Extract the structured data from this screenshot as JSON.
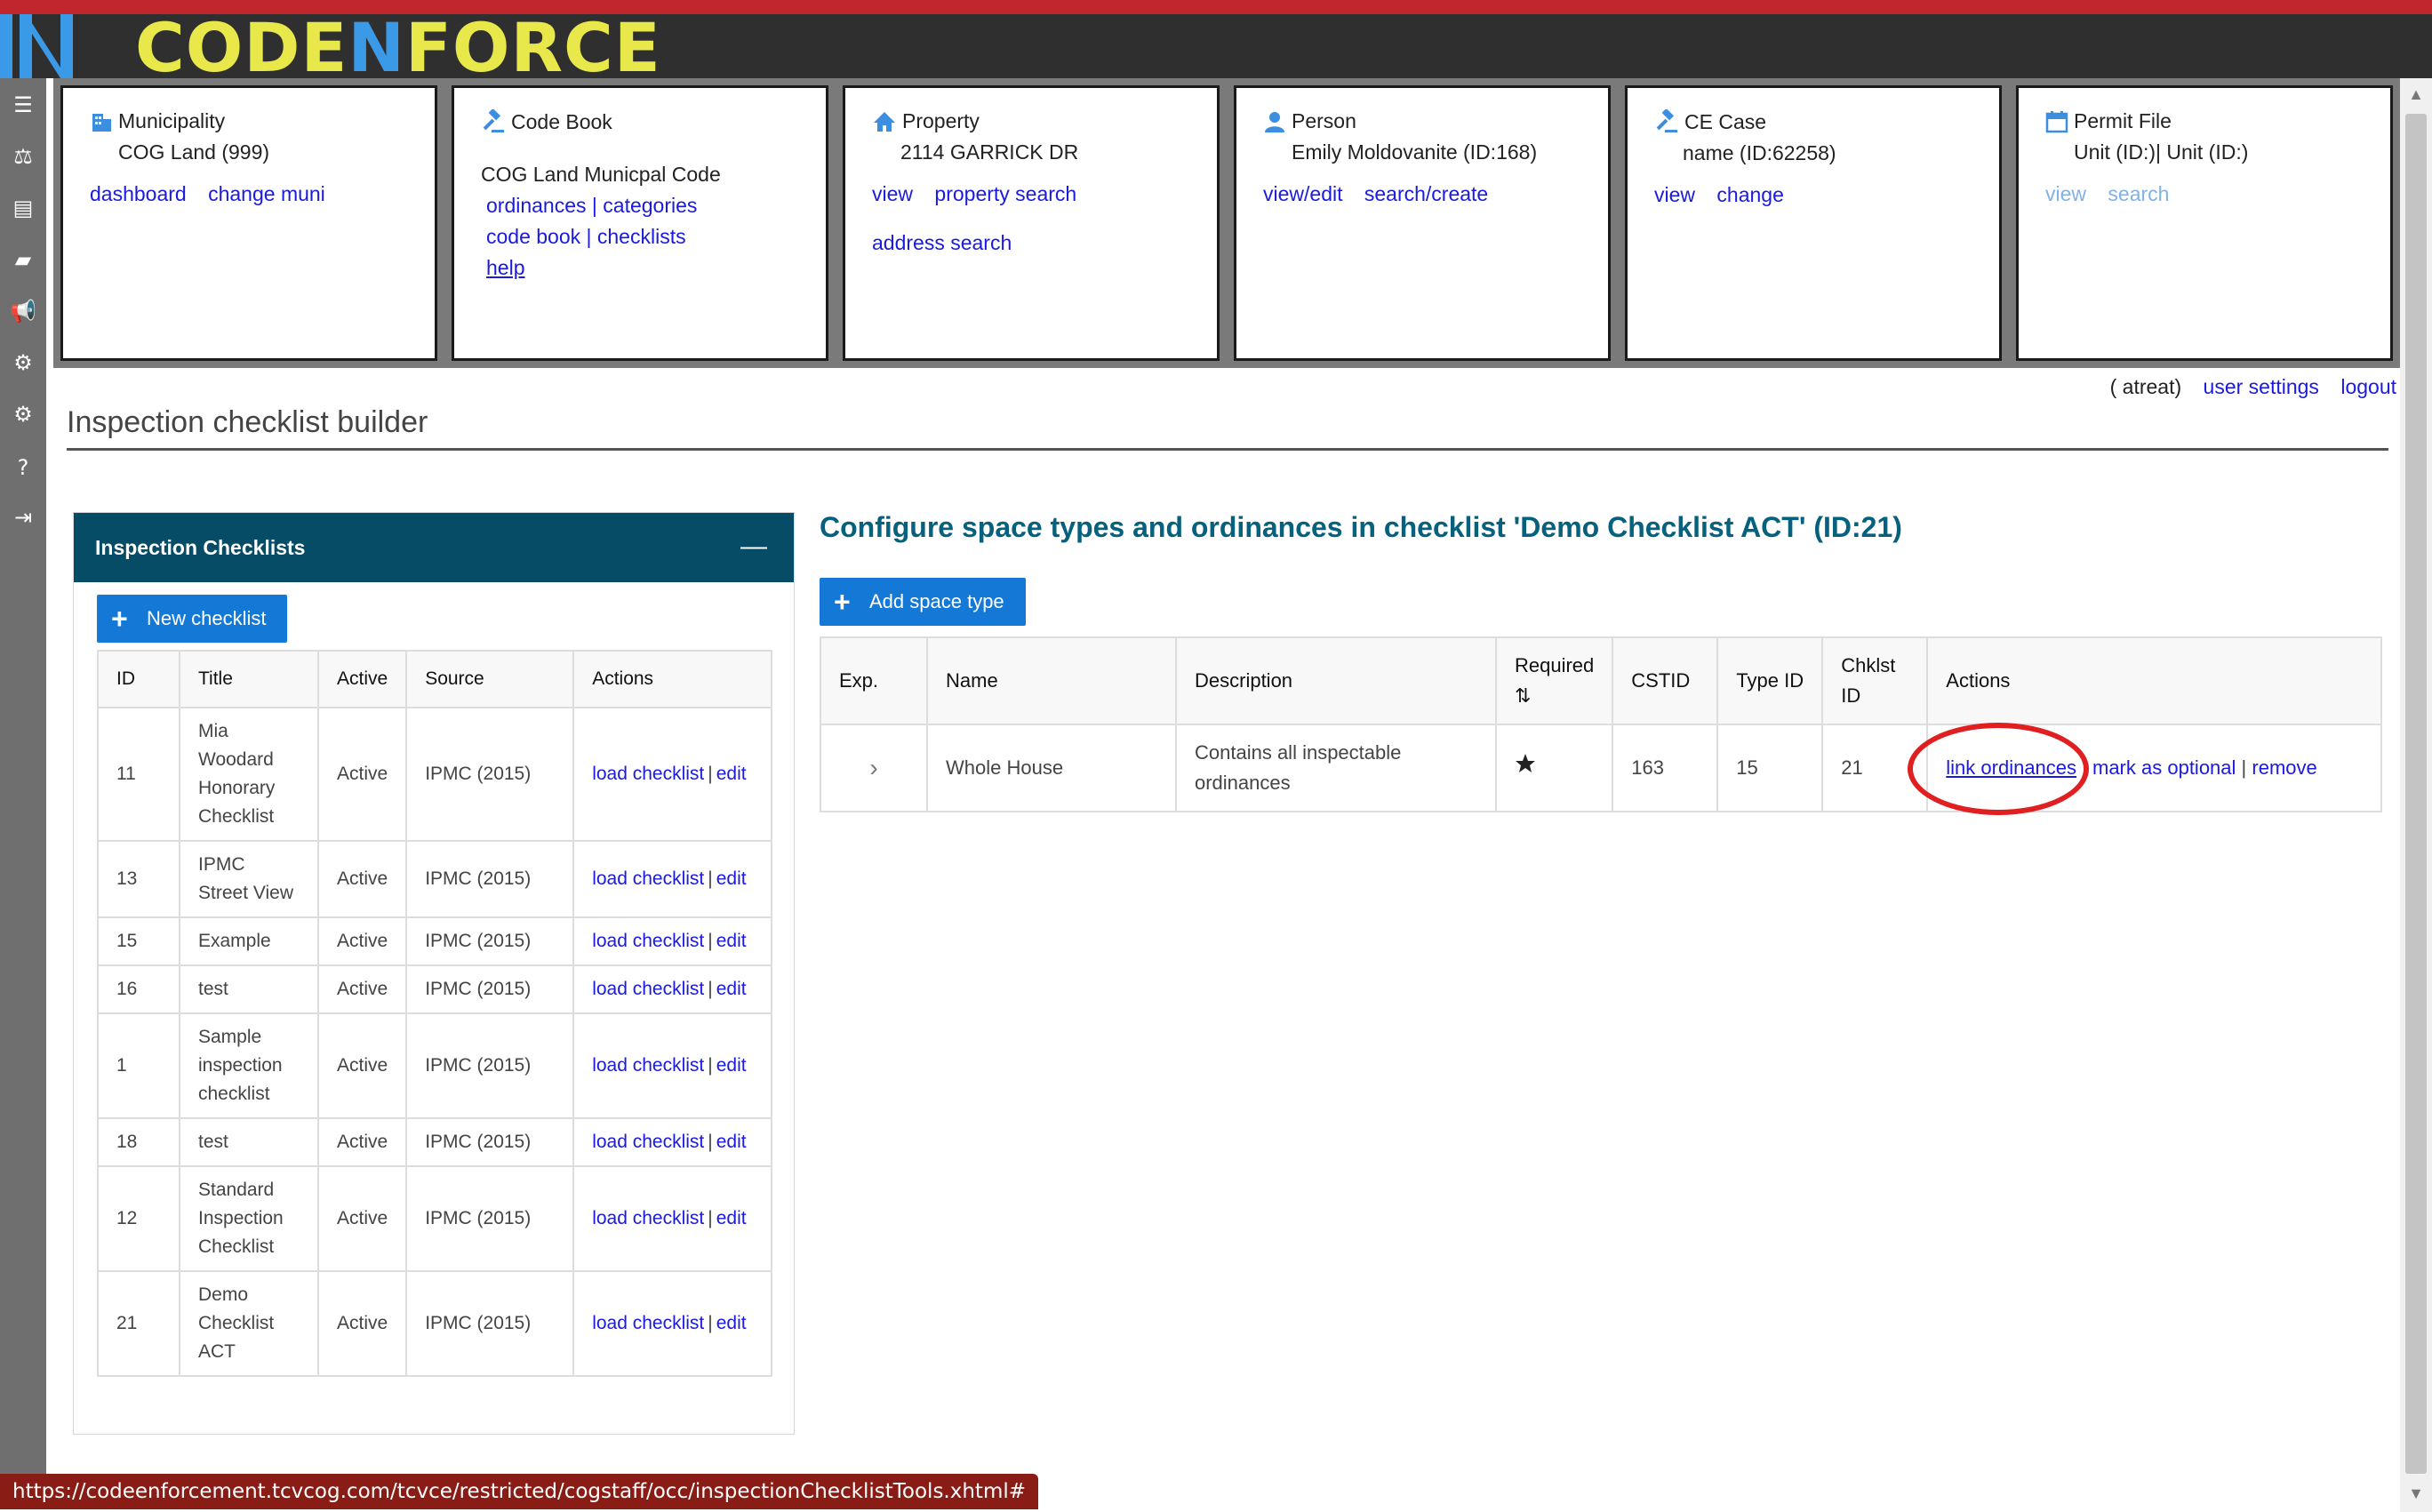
{
  "app": {
    "logo_text": "CODENFORCE",
    "colors": {
      "header": "#2f2f2f",
      "brand_yellow": "#e8e84a",
      "brand_blue": "#3b9ae8",
      "panel_head": "#074c67",
      "button": "#1479d6",
      "link": "#1a1ae0",
      "highlight_circle": "#e02020"
    }
  },
  "sidebar": {
    "icons": [
      "list-icon",
      "scales-icon",
      "card-icon",
      "book-icon",
      "megaphone-icon",
      "gears-icon",
      "gears-icon",
      "help-icon",
      "logout-icon"
    ]
  },
  "cards": {
    "municipality": {
      "title": "Municipality",
      "value": "COG Land (999)",
      "links": [
        "dashboard",
        "change muni"
      ]
    },
    "codebook": {
      "title": "Code Book",
      "value": "COG Land Municpal Code",
      "links": [
        "ordinances | categories",
        "code book | checklists",
        "help"
      ]
    },
    "property": {
      "title": "Property",
      "value": "2114 GARRICK DR",
      "links": [
        "view",
        "property search",
        "address search"
      ]
    },
    "person": {
      "title": "Person",
      "value": "Emily Moldovanite (ID:168)",
      "links": [
        "view/edit",
        "search/create"
      ]
    },
    "cecase": {
      "title": "CE Case",
      "value": "name (ID:62258)",
      "links": [
        "view",
        "change"
      ]
    },
    "permit": {
      "title": "Permit File",
      "value": "Unit (ID:)| Unit (ID:)",
      "links": [
        "view",
        "search"
      ]
    }
  },
  "user": {
    "name": "( atreat)",
    "settings": "user settings",
    "logout": "logout"
  },
  "page_title": "Inspection checklist builder",
  "left_panel": {
    "title": "Inspection Checklists",
    "collapse": "—",
    "new_button": "New checklist",
    "columns": [
      "ID",
      "Title",
      "Active",
      "Source",
      "Actions"
    ],
    "load_label": "load checklist",
    "sep": "|",
    "edit_label": "edit",
    "rows": [
      {
        "id": "11",
        "title": "Mia Woodard Honorary Checklist",
        "active": "Active",
        "source": "IPMC (2015)"
      },
      {
        "id": "13",
        "title": "IPMC Street View",
        "active": "Active",
        "source": "IPMC (2015)"
      },
      {
        "id": "15",
        "title": "Example",
        "active": "Active",
        "source": "IPMC (2015)"
      },
      {
        "id": "16",
        "title": "test",
        "active": "Active",
        "source": "IPMC (2015)"
      },
      {
        "id": "1",
        "title": "Sample inspection checklist",
        "active": "Active",
        "source": "IPMC (2015)"
      },
      {
        "id": "18",
        "title": "test",
        "active": "Active",
        "source": "IPMC (2015)"
      },
      {
        "id": "12",
        "title": "Standard Inspection Checklist",
        "active": "Active",
        "source": "IPMC (2015)"
      },
      {
        "id": "21",
        "title": "Demo Checklist ACT",
        "active": "Active",
        "source": "IPMC (2015)"
      }
    ]
  },
  "right_panel": {
    "title": "Configure space types and ordinances in checklist 'Demo Checklist ACT' (ID:21)",
    "add_button": "Add space type",
    "columns": {
      "exp": "Exp.",
      "name": "Name",
      "description": "Description",
      "required": "Required",
      "sort_icon": "⇅",
      "cstid": "CSTID",
      "typeid": "Type ID",
      "chklist": "Chklst ID",
      "actions": "Actions"
    },
    "row": {
      "expand_icon": "chevron-right-icon",
      "name": "Whole House",
      "description": "Contains all inspectable ordinances",
      "required_icon": "star-icon",
      "cstid": "163",
      "typeid": "15",
      "chklist": "21",
      "link_ordinances": "link ordinances",
      "sep": "|",
      "mark_optional": "mark as optional",
      "sep2": "|",
      "remove": "remove"
    }
  },
  "status_url": "https://codeenforcement.tcvcog.com/tcvce/restricted/cogstaff/occ/inspectionChecklistTools.xhtml#"
}
